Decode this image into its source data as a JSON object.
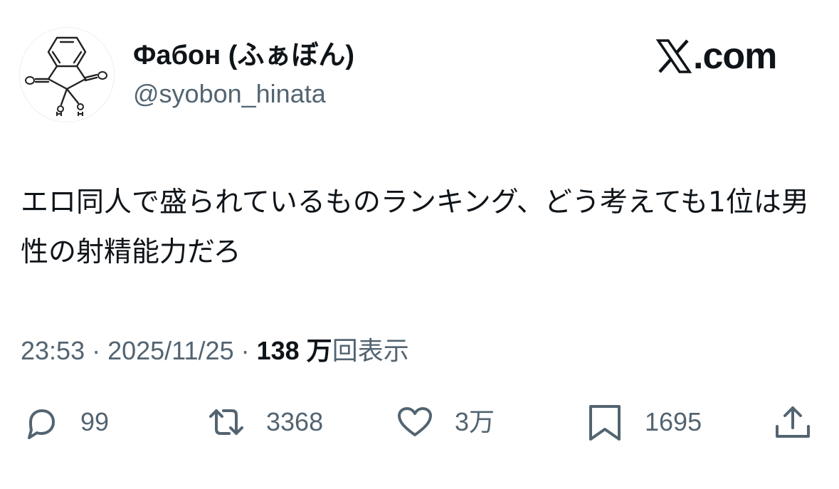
{
  "author": {
    "display_name": "Фабон (ふぁぼん)",
    "handle": "@syobon_hinata"
  },
  "brand": {
    "text": ".com",
    "icon": "x-logo-icon"
  },
  "tweet": {
    "text": "エロ同人で盛られているものランキング、どう考えても1位は男性の射精能力だろ"
  },
  "meta": {
    "time": "23:53",
    "separator": " · ",
    "date": "2025/11/25",
    "views_count": "138 万",
    "views_label": "回表示"
  },
  "actions": {
    "reply": {
      "icon": "reply-icon",
      "count": "99"
    },
    "retweet": {
      "icon": "retweet-icon",
      "count": "3368"
    },
    "like": {
      "icon": "heart-icon",
      "count": "3万"
    },
    "bookmark": {
      "icon": "bookmark-icon",
      "count": "1695"
    },
    "share": {
      "icon": "share-icon"
    }
  },
  "colors": {
    "text": "#0f1419",
    "secondary": "#536471"
  }
}
